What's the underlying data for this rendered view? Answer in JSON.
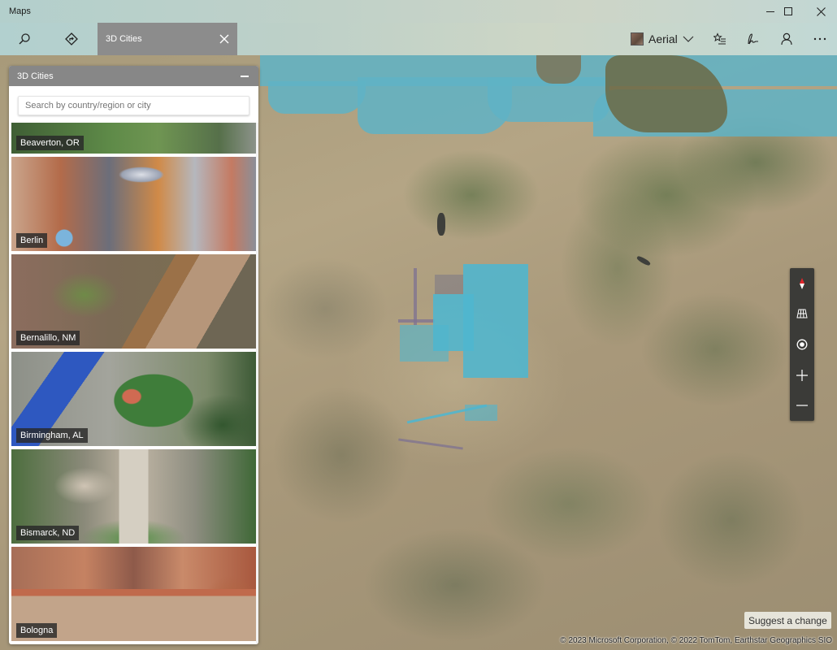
{
  "window": {
    "app_title": "Maps",
    "minimize_icon": "minimize-icon",
    "maximize_icon": "maximize-icon",
    "close_icon": "close-icon"
  },
  "toolbar": {
    "search_icon": "search-icon",
    "directions_icon": "directions-icon",
    "active_tab": {
      "label": "3D Cities",
      "close_icon": "close-icon"
    },
    "map_style": {
      "label": "Aerial",
      "thumb_icon": "aerial-thumbnail-icon",
      "chevron": "chevron-down-icon"
    },
    "favorites_icon": "favorites-list-icon",
    "ink_icon": "ink-pen-icon",
    "account_icon": "person-icon",
    "more_icon": "more-ellipsis-icon"
  },
  "panel": {
    "title": "3D Cities",
    "minimize_icon": "minimize-icon",
    "search_placeholder": "Search by country/region or city",
    "search_value": "",
    "cities": [
      {
        "name": "Beaverton, OR"
      },
      {
        "name": "Berlin"
      },
      {
        "name": "Bernalillo, NM"
      },
      {
        "name": "Birmingham, AL"
      },
      {
        "name": "Bismarck, ND"
      },
      {
        "name": "Bologna"
      }
    ]
  },
  "map_controls": {
    "compass_icon": "compass-icon",
    "tilt_icon": "tilt-grid-icon",
    "location_icon": "my-location-icon",
    "zoom_in_icon": "plus-icon",
    "zoom_out_icon": "minus-icon"
  },
  "map": {
    "suggest_label": "Suggest a change",
    "copyright": "© 2023 Microsoft Corporation, © 2022 TomTom, Earthstar Geographics SIO",
    "accent_water": "#5fb3c6",
    "accent_city": "#4fb6cf",
    "compass_north_color": "#e0262b"
  }
}
